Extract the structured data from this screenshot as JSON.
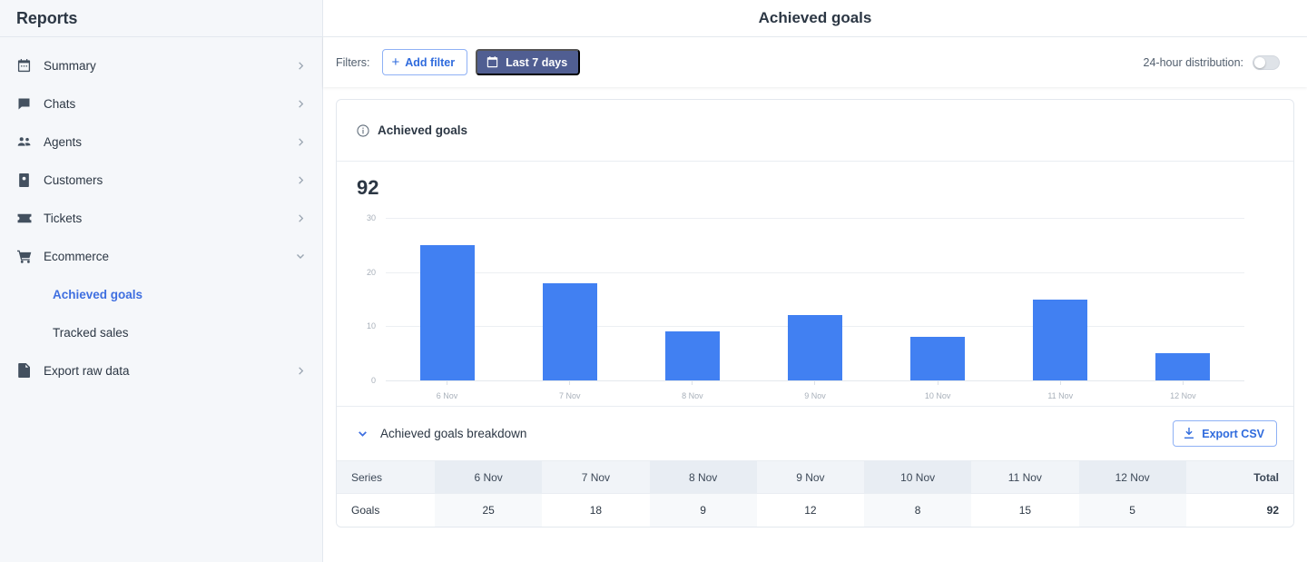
{
  "sidebar": {
    "title": "Reports",
    "items": [
      {
        "label": "Summary",
        "icon": "calendar-icon",
        "chevron": "chevron-right-icon"
      },
      {
        "label": "Chats",
        "icon": "chat-bubble-icon",
        "chevron": "chevron-right-icon"
      },
      {
        "label": "Agents",
        "icon": "people-icon",
        "chevron": "chevron-right-icon"
      },
      {
        "label": "Customers",
        "icon": "contact-card-icon",
        "chevron": "chevron-right-icon"
      },
      {
        "label": "Tickets",
        "icon": "ticket-icon",
        "chevron": "chevron-right-icon"
      },
      {
        "label": "Ecommerce",
        "icon": "shopping-cart-icon",
        "chevron": "chevron-down-icon"
      }
    ],
    "sub_items": [
      {
        "label": "Achieved goals",
        "active": true
      },
      {
        "label": "Tracked sales",
        "active": false
      }
    ],
    "footer_item": {
      "label": "Export raw data",
      "icon": "document-icon",
      "chevron": "chevron-right-icon"
    }
  },
  "header": {
    "title": "Achieved goals"
  },
  "filters": {
    "label": "Filters:",
    "add_filter_label": "Add filter",
    "add_filter_glyph": "+",
    "date_range_label": "Last 7 days",
    "date_range_icon": "calendar-icon",
    "distribution_label": "24-hour distribution:",
    "distribution_on": false
  },
  "card": {
    "title": "Achieved goals",
    "info_icon": "info-circle-icon",
    "total": "92"
  },
  "breakdown": {
    "title": "Achieved goals breakdown",
    "chevron": "chevron-down-icon",
    "export_label": "Export CSV",
    "export_icon": "download-icon",
    "columns": [
      "Series",
      "6 Nov",
      "7 Nov",
      "8 Nov",
      "9 Nov",
      "10 Nov",
      "11 Nov",
      "12 Nov",
      "Total"
    ],
    "rows": [
      {
        "series": "Goals",
        "values": [
          "25",
          "18",
          "9",
          "12",
          "8",
          "15",
          "5"
        ],
        "total": "92"
      }
    ]
  },
  "chart_data": {
    "type": "bar",
    "title": "Achieved goals",
    "categories": [
      "6 Nov",
      "7 Nov",
      "8 Nov",
      "9 Nov",
      "10 Nov",
      "11 Nov",
      "12 Nov"
    ],
    "series": [
      {
        "name": "Goals",
        "values": [
          25,
          18,
          9,
          12,
          8,
          15,
          5
        ],
        "color": "#4180f2"
      }
    ],
    "values": [
      25,
      18,
      9,
      12,
      8,
      15,
      5
    ],
    "total": 92,
    "xlabel": "",
    "ylabel": "",
    "ylim": [
      0,
      30
    ],
    "yticks": [
      0,
      10,
      20,
      30
    ],
    "grid": true,
    "legend": "none",
    "bar_color": "#4180f2"
  },
  "colors": {
    "accent": "#3f6fe0",
    "bar": "#4180f2",
    "daterange_bg": "#505e92",
    "sidebar_bg": "#f5f7fa",
    "text": "#2c3744"
  }
}
